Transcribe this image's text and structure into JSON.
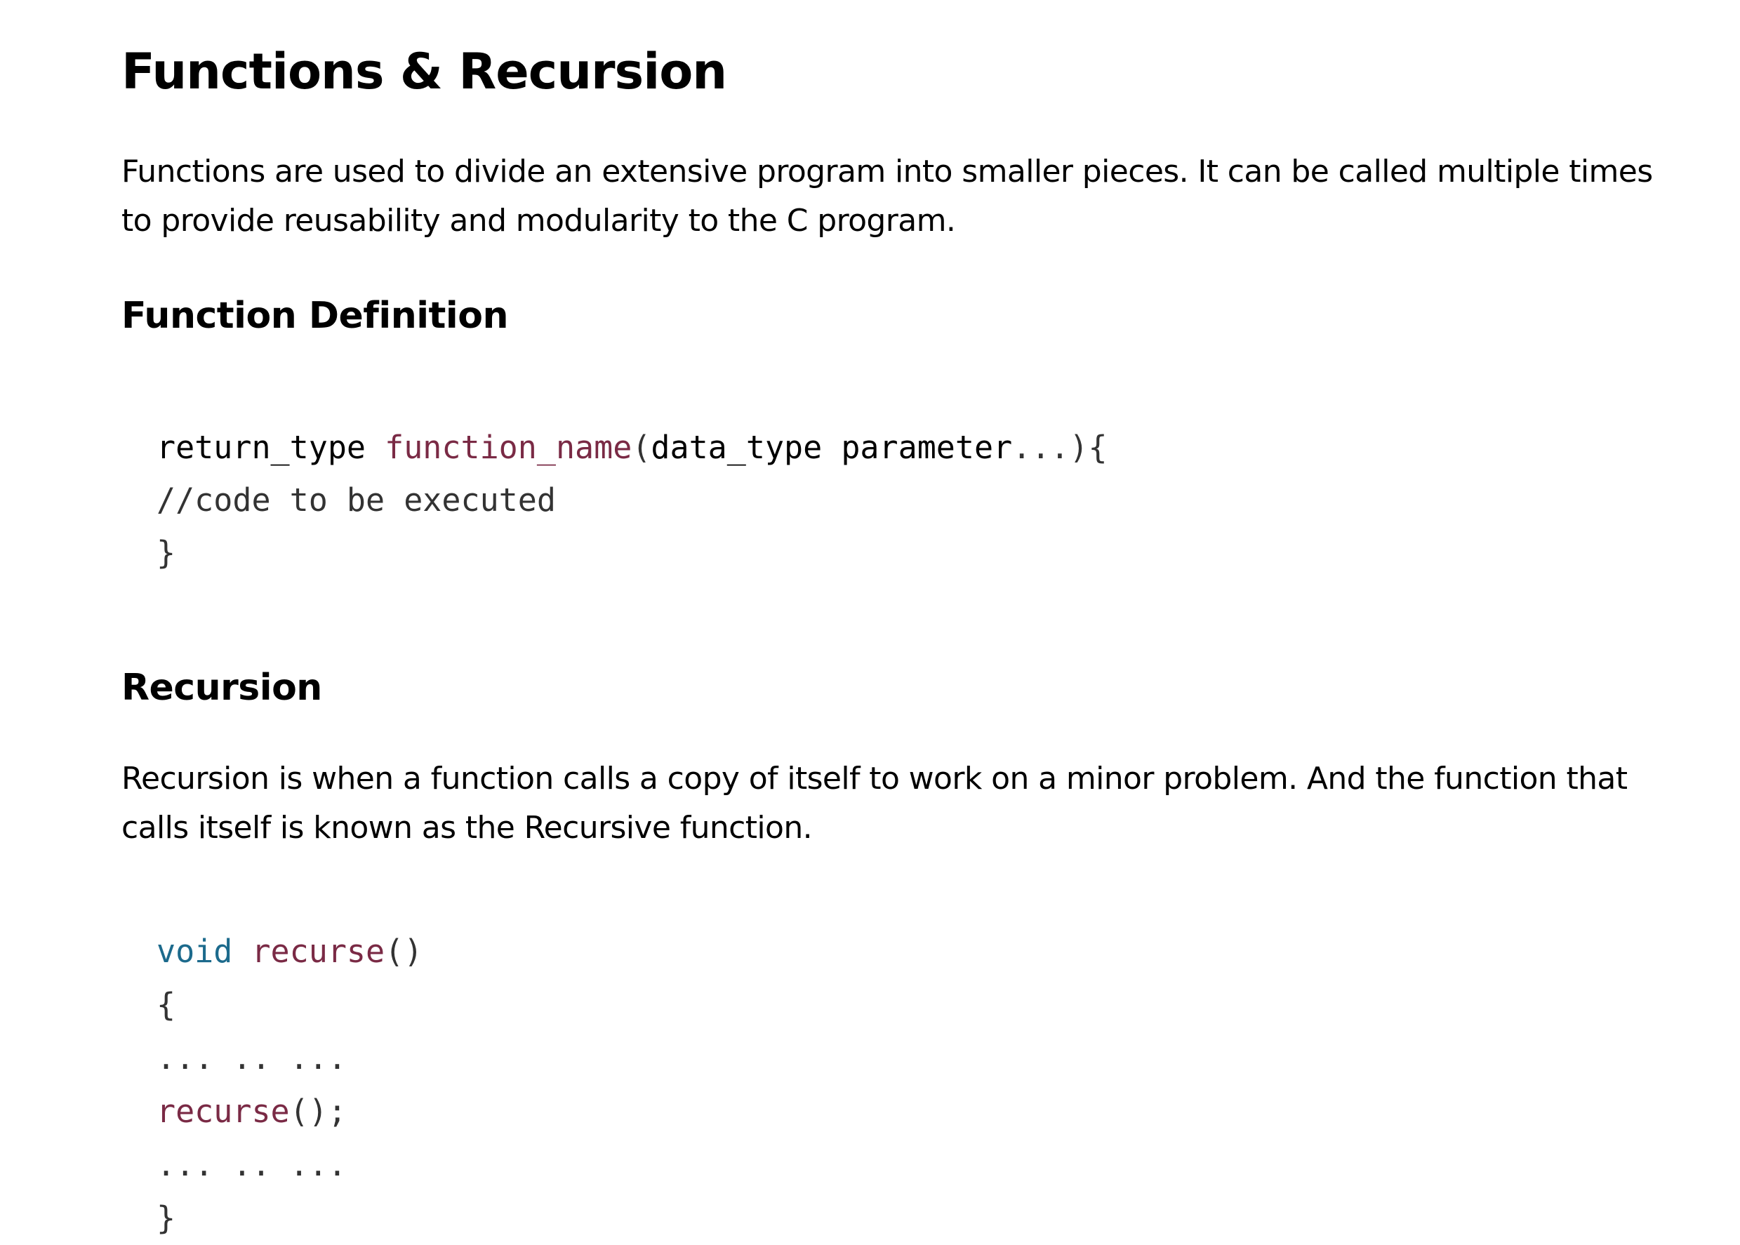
{
  "title": "Functions & Recursion",
  "intro": "Functions are used to divide an extensive program into smaller pieces. It can be called multiple times to provide reusability and modularity to the C program.",
  "section_function_definition": {
    "heading": "Function Definition",
    "code": {
      "line1": {
        "return_type": "return_type",
        "name": "function_name",
        "open_paren": "(",
        "params": "data_type parameter",
        "rest": "...){"
      },
      "line2": "//code to be executed",
      "line3": "}"
    }
  },
  "section_recursion": {
    "heading": "Recursion",
    "description": "Recursion is when a function calls a copy of itself to work on a minor problem. And the function that calls itself is known as the Recursive function.",
    "code": {
      "line1": {
        "keyword": "void",
        "name": "recurse",
        "parens": "()"
      },
      "line2": "{",
      "line3": "... .. ...",
      "line4": {
        "name": "recurse",
        "rest": "();"
      },
      "line5": "... .. ...",
      "line6": "}"
    }
  },
  "colors": {
    "text": "#000000",
    "code_text": "#333333",
    "function_name": "#7a2a45",
    "keyword": "#1c6a8c"
  }
}
